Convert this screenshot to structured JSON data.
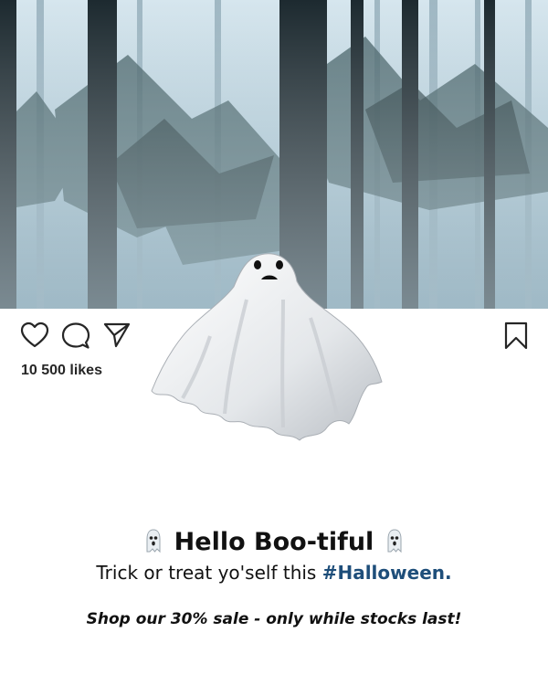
{
  "post": {
    "photo": {
      "subject": "misty-pine-forest",
      "sky_color": "#c9dde6",
      "fog_color": "#8fb0bf",
      "trunk_color": "#1d2a30"
    },
    "actions": {
      "like_icon": "heart-icon",
      "comment_icon": "comment-bubble-icon",
      "share_icon": "paper-plane-icon",
      "save_icon": "bookmark-icon"
    },
    "likes_text": "10 500 likes",
    "caption": {
      "headline": "Hello Boo-tiful",
      "emoji_icon": "ghost-emoji-icon",
      "subline_text": "Trick or treat yo'self this",
      "hashtag": "#Halloween.",
      "hashtag_color": "#1e4e7a",
      "promo": "Shop our 30% sale - only while stocks last!"
    }
  }
}
